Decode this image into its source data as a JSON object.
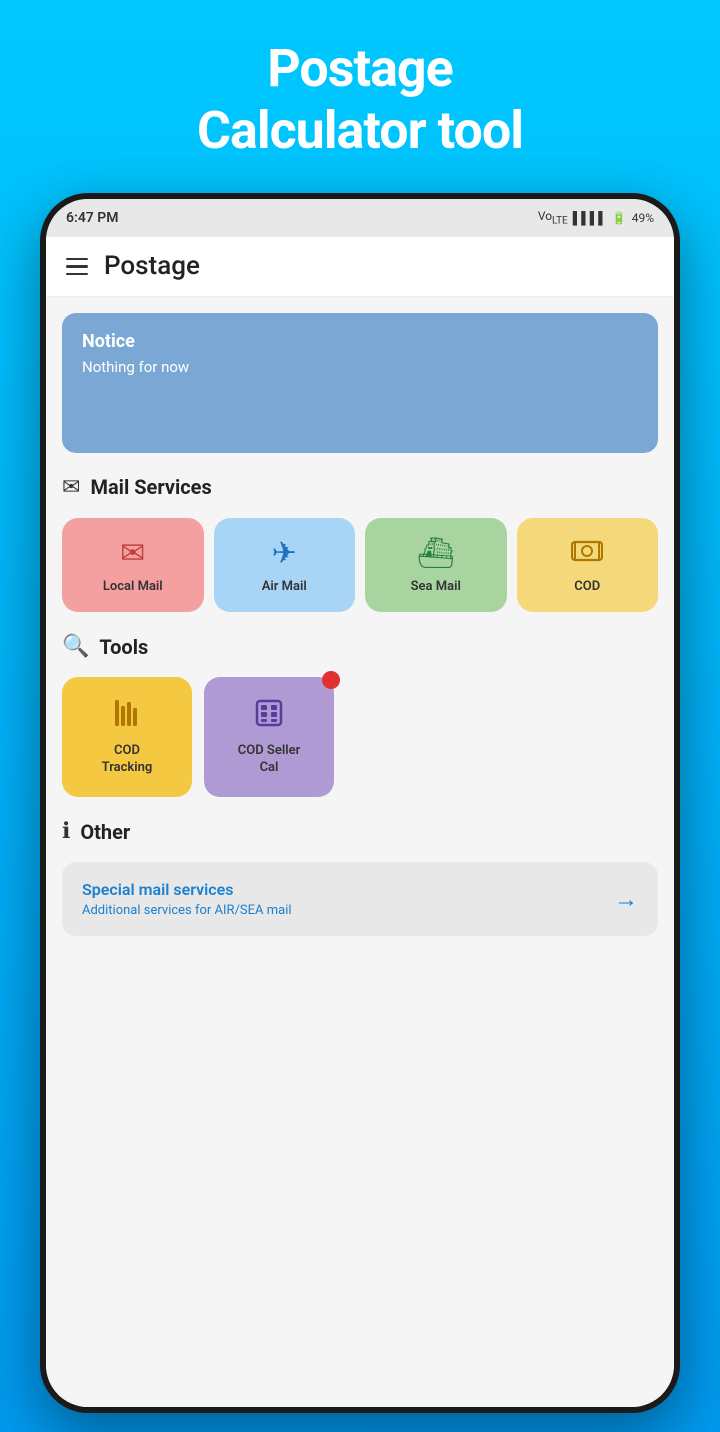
{
  "page": {
    "background_title_line1": "Postage",
    "background_title_line2": "Calculator tool"
  },
  "status_bar": {
    "time": "6:47 PM",
    "signal": "▌▌▌▌",
    "battery": "49%"
  },
  "app_bar": {
    "title": "Postage"
  },
  "notice": {
    "title": "Notice",
    "body": "Nothing for now"
  },
  "mail_services": {
    "section_title": "Mail Services",
    "items": [
      {
        "id": "local-mail",
        "label": "Local Mail",
        "icon": "✉"
      },
      {
        "id": "air-mail",
        "label": "Air Mail",
        "icon": "✈"
      },
      {
        "id": "sea-mail",
        "label": "Sea Mail",
        "icon": "🚢"
      },
      {
        "id": "cod",
        "label": "COD",
        "icon": "💰"
      }
    ]
  },
  "tools": {
    "section_title": "Tools",
    "items": [
      {
        "id": "cod-tracking",
        "label": "COD\nTracking",
        "icon": "▊▊▊",
        "has_dot": false
      },
      {
        "id": "cod-seller",
        "label": "COD Seller\nCal",
        "icon": "🧮",
        "has_dot": true
      }
    ]
  },
  "other": {
    "section_title": "Other",
    "card_title": "Special mail services",
    "card_subtitle": "Additional services for AIR/SEA mail"
  }
}
